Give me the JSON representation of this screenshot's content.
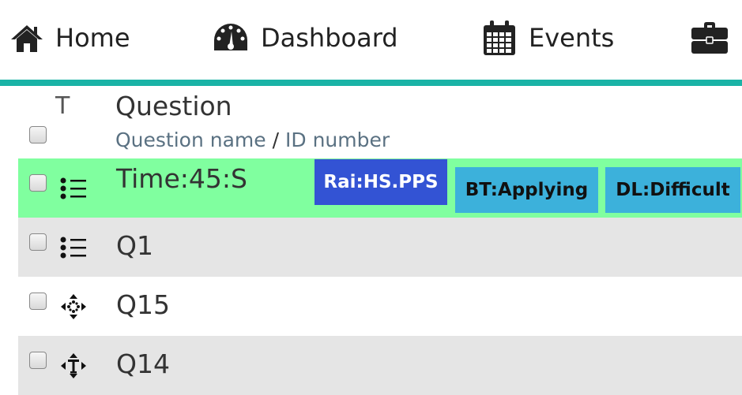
{
  "nav": {
    "items": [
      {
        "label": "Home",
        "icon": "home-icon"
      },
      {
        "label": "Dashboard",
        "icon": "dashboard-icon"
      },
      {
        "label": "Events",
        "icon": "calendar-icon"
      },
      {
        "label": "",
        "icon": "briefcase-icon"
      }
    ],
    "accent_color": "#1ab3a6"
  },
  "table": {
    "header": {
      "type_label": "T",
      "title": "Question",
      "sub_name": "Question name",
      "sub_sep": "/",
      "sub_id": "ID number"
    },
    "rows": [
      {
        "name": "Time:45:S",
        "icon": "multichoice-icon",
        "highlight": "#80ff9f",
        "tags": [
          {
            "label": "Rai:HS.PPS",
            "bg": "#3353d4",
            "color": "#ffffff"
          },
          {
            "label": "BT:Applying",
            "bg": "#3cb1db",
            "color": "#111111"
          },
          {
            "label": "DL:Difficult",
            "bg": "#3cb1db",
            "color": "#111111"
          }
        ]
      },
      {
        "name": "Q1",
        "icon": "multichoice-icon",
        "bg": "#e5e5e5"
      },
      {
        "name": "Q15",
        "icon": "drag-drop-marker-icon",
        "bg": "#ffffff"
      },
      {
        "name": "Q14",
        "icon": "drag-drop-text-icon",
        "bg": "#e5e5e5"
      }
    ]
  }
}
